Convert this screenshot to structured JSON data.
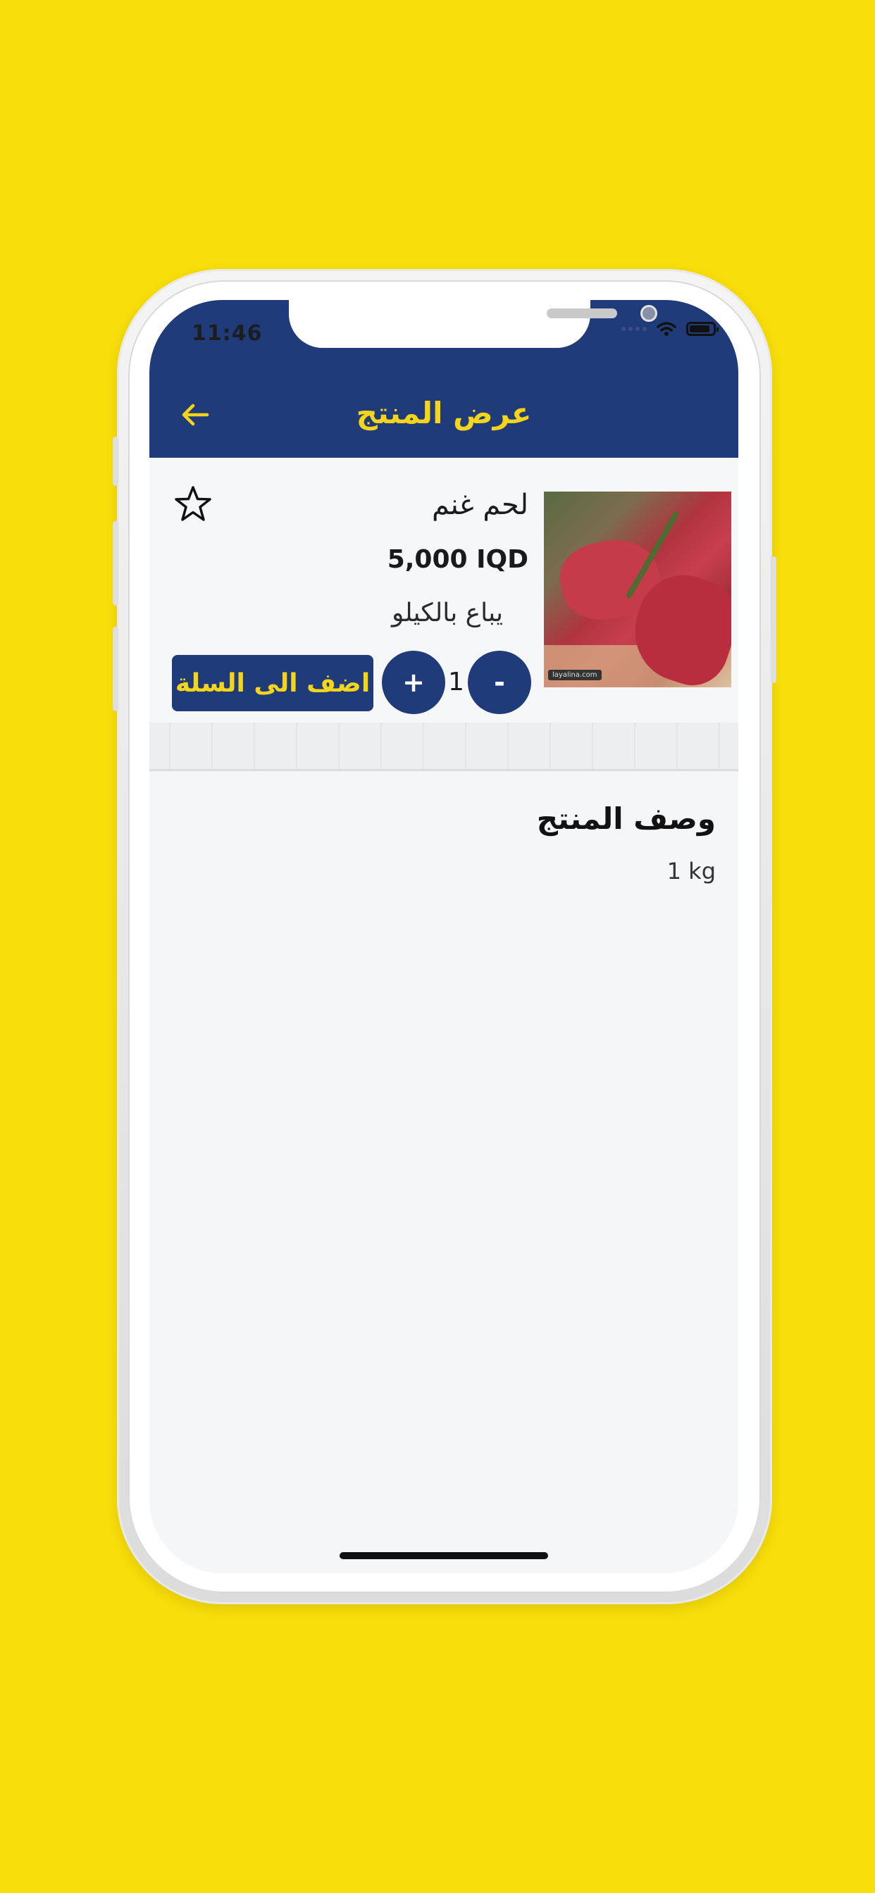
{
  "colors": {
    "background": "#f8de0a",
    "header": "#203b7a",
    "accent_yellow": "#f4d51a",
    "button": "#203b7a"
  },
  "status_bar": {
    "time": "11:46"
  },
  "header": {
    "title": "عرض المنتج",
    "back_icon": "arrow-left-icon"
  },
  "product": {
    "name": "لحم غنم",
    "price": "5,000 IQD",
    "unit_note": "يباع بالكيلو",
    "quantity": "1",
    "minus_label": "-",
    "plus_label": "+",
    "add_to_cart_label": "اضف الى السلة",
    "favorite_icon": "star-outline-icon",
    "image_watermark": "layalina.com"
  },
  "description": {
    "title": "وصف المنتج",
    "value": "1 kg"
  }
}
